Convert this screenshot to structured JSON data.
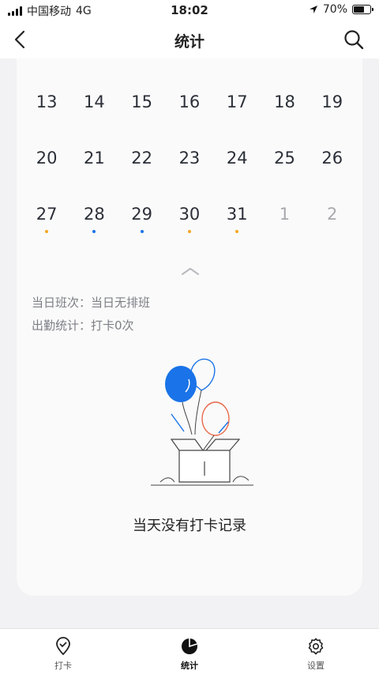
{
  "status_bar": {
    "carrier": "中国移动",
    "network": "4G",
    "time": "18:02",
    "battery": "70%",
    "battery_level": 0.7
  },
  "nav": {
    "title": "统计"
  },
  "calendar": {
    "rows": [
      [
        {
          "day": "13"
        },
        {
          "day": "14"
        },
        {
          "day": "15"
        },
        {
          "day": "16"
        },
        {
          "day": "17"
        },
        {
          "day": "18"
        },
        {
          "day": "19"
        }
      ],
      [
        {
          "day": "20"
        },
        {
          "day": "21"
        },
        {
          "day": "22"
        },
        {
          "day": "23"
        },
        {
          "day": "24"
        },
        {
          "day": "25"
        },
        {
          "day": "26"
        }
      ],
      [
        {
          "day": "27",
          "dot": "#f5a623"
        },
        {
          "day": "28",
          "dot": "#1a73e8"
        },
        {
          "day": "29",
          "dot": "#1a73e8"
        },
        {
          "day": "30",
          "dot": "#f5a623"
        },
        {
          "day": "31",
          "dot": "#f5a623"
        },
        {
          "day": "1",
          "muted": true
        },
        {
          "day": "2",
          "muted": true
        }
      ]
    ]
  },
  "info": {
    "shift": "当日班次：当日无排班",
    "attendance": "出勤统计：打卡0次"
  },
  "empty_state": {
    "text": "当天没有打卡记录"
  },
  "tabs": [
    {
      "label": "打卡",
      "icon": "location-check-icon",
      "active": false
    },
    {
      "label": "统计",
      "icon": "pie-chart-icon",
      "active": true
    },
    {
      "label": "设置",
      "icon": "gear-icon",
      "active": false
    }
  ],
  "colors": {
    "accent_blue": "#1a73e8",
    "accent_orange": "#f5a623",
    "balloon_red": "#e8694a"
  }
}
